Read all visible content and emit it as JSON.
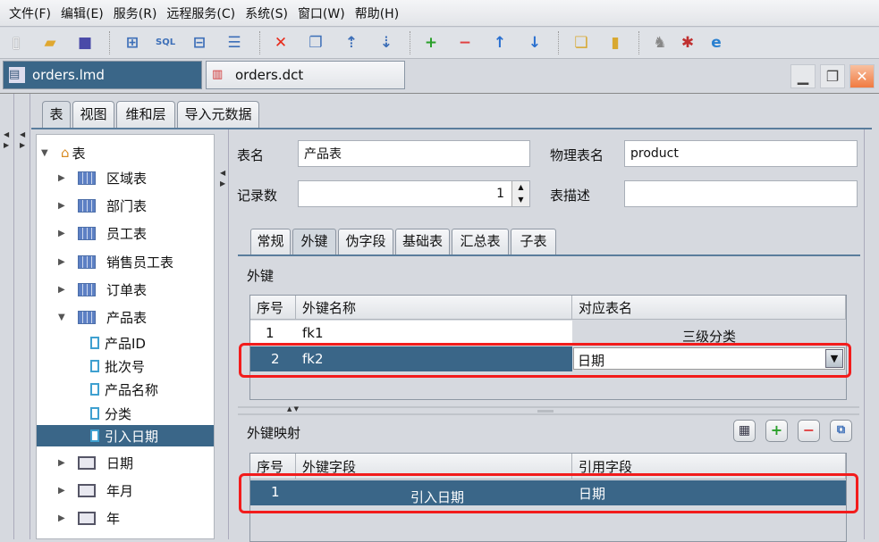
{
  "menu": [
    "文件(F)",
    "编辑(E)",
    "服务(R)",
    "远程服务(C)",
    "系统(S)",
    "窗口(W)",
    "帮助(H)"
  ],
  "toolbar": [
    "new-file",
    "open-folder",
    "save",
    "add-table",
    "add-sql-table",
    "add-view",
    "add-dimension",
    "delete",
    "copy",
    "move-up-table",
    "move-down-table",
    "add",
    "remove",
    "up",
    "down",
    "db-copy",
    "database",
    "deploy",
    "debug",
    "browser"
  ],
  "doc_tabs": [
    {
      "label": "orders.lmd",
      "active": true
    },
    {
      "label": "orders.dct",
      "active": false
    }
  ],
  "left_tabs": [
    "表",
    "视图",
    "维和层",
    "导入元数据"
  ],
  "tree": {
    "root": "表",
    "tables": [
      "区域表",
      "部门表",
      "员工表",
      "销售员工表",
      "订单表",
      "产品表"
    ],
    "fields": [
      "产品ID",
      "批次号",
      "产品名称",
      "分类",
      "引入日期"
    ],
    "selected_field": "引入日期",
    "dims": [
      "日期",
      "年月",
      "年"
    ]
  },
  "form": {
    "name_label": "表名",
    "name_value": "产品表",
    "phys_label": "物理表名",
    "phys_value": "product",
    "count_label": "记录数",
    "count_value": "1",
    "desc_label": "表描述",
    "desc_value": ""
  },
  "sub_tabs": [
    "常规",
    "外键",
    "伪字段",
    "基础表",
    "汇总表",
    "子表"
  ],
  "fk": {
    "title": "外键",
    "headers": [
      "序号",
      "外键名称",
      "对应表名"
    ],
    "rows": [
      [
        "1",
        "fk1",
        "三级分类"
      ],
      [
        "2",
        "fk2",
        "日期"
      ]
    ]
  },
  "map": {
    "title": "外键映射",
    "headers": [
      "序号",
      "外键字段",
      "引用字段"
    ],
    "rows": [
      [
        "1",
        "引入日期",
        "日期"
      ]
    ]
  },
  "colors": {
    "selection": "#3a6688",
    "highlight": "#f21c1c"
  }
}
